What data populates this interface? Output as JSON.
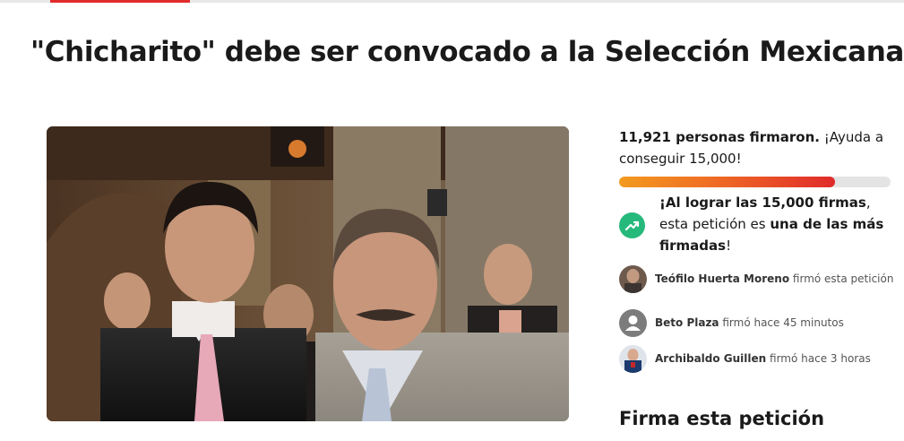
{
  "petition": {
    "title": "\"Chicharito\" debe ser convocado a la Selección Mexicana"
  },
  "progress": {
    "count_bold": "11,921 personas firmaron.",
    "count_rest": " ¡Ayuda a conseguir 15,000!",
    "fraction": 0.7947
  },
  "milestone": {
    "part1": "¡Al lograr las 15,000 firmas",
    "part2": ", esta petición es ",
    "part3": "una de las más firmadas",
    "part4": "!"
  },
  "signers": [
    {
      "name": "Teófilo Huerta Moreno",
      "action": " firmó esta petición"
    },
    {
      "name": "Beto Plaza",
      "action": " firmó hace 45 minutos"
    },
    {
      "name": "Archibaldo Guillen",
      "action": " firmó hace 3 horas"
    }
  ],
  "sign_section": {
    "heading": "Firma esta petición"
  },
  "colors": {
    "accent": "#e02b2b",
    "progress_start": "#f39b1f",
    "milestone_icon": "#26b97c"
  },
  "icons": {
    "milestone": "trending-up-icon",
    "default_avatar": "user-icon"
  }
}
